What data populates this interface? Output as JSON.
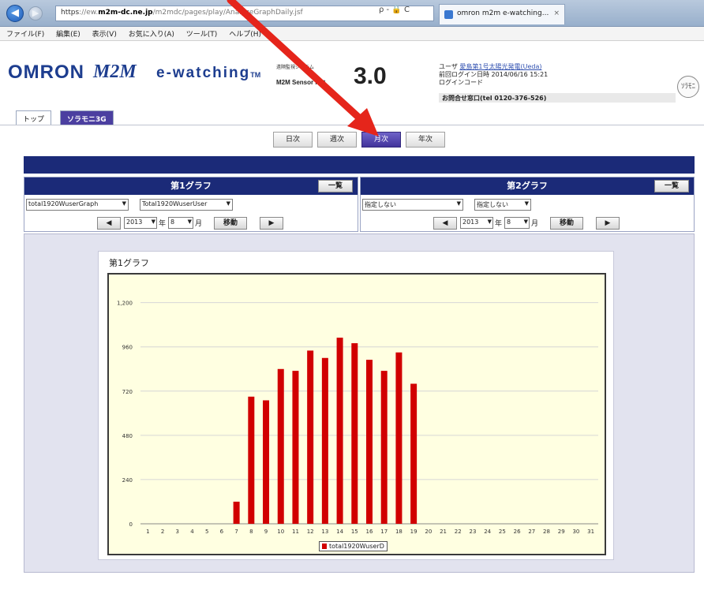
{
  "browser": {
    "url_scheme": "https",
    "url_host_prefix": "://ew.",
    "url_host": "m2m-dc.ne.jp",
    "url_path": "/m2mdc/pages/play/AnalyzeGraphDaily.jsf",
    "url_tools": "ρ - 🔒 C",
    "tab_title": "omron m2m e-watching...",
    "tab_close": "×"
  },
  "menu": [
    "ファイル(F)",
    "編集(E)",
    "表示(V)",
    "お気に入り(A)",
    "ツール(T)",
    "ヘルプ(H)"
  ],
  "header": {
    "brand": "OMRON",
    "product_m2m": "M2M",
    "product_ew": "e-watching",
    "tm": "TM",
    "sys_caption": "遠隔監視システム",
    "sys_name": "M2M Sensor Net",
    "version": "3.0",
    "user_label": "ユーザ",
    "user_name": "愛島第1号太陽光発電(Ueda)",
    "last_login_label": "前回ログイン日時",
    "last_login": "2014/06/16 15:21",
    "user_code_label": "ログインコード",
    "contact": "お問合せ窓口(tel 0120-376-526)",
    "right_icon": "ｿﾗﾓﾆ"
  },
  "site_tabs": {
    "top": "トップ",
    "sora": "ソラモニ3G"
  },
  "period": {
    "daily": "日次",
    "weekly": "週次",
    "monthly": "月次",
    "yearly": "年次"
  },
  "panel1": {
    "title": "第1グラフ",
    "list_btn": "一覧",
    "select1": "total1920WuserGraph",
    "select2": "Total1920WuserUser",
    "year": "2013",
    "year_unit": "年",
    "month": "8",
    "month_unit": "月",
    "move_btn": "移動",
    "prev": "◀",
    "next": "▶"
  },
  "panel2": {
    "title": "第2グラフ",
    "list_btn": "一覧",
    "select1": "指定しない",
    "select2": "指定しない",
    "year": "2013",
    "year_unit": "年",
    "month": "8",
    "month_unit": "月",
    "move_btn": "移動",
    "prev": "◀",
    "next": "▶"
  },
  "colors": {
    "navy": "#1b2a78",
    "bar": "#d10000",
    "plot_bg": "#ffffe1",
    "annot_arrow": "#e5251b"
  },
  "chart_data": {
    "type": "bar",
    "title": "第1グラフ",
    "categories": [
      "1",
      "2",
      "3",
      "4",
      "5",
      "6",
      "7",
      "8",
      "9",
      "10",
      "11",
      "12",
      "13",
      "14",
      "15",
      "16",
      "17",
      "18",
      "19",
      "20",
      "21",
      "22",
      "23",
      "24",
      "25",
      "26",
      "27",
      "28",
      "29",
      "30",
      "31"
    ],
    "series": [
      {
        "name": "total1920WuserD",
        "values": [
          0,
          0,
          0,
          0,
          0,
          0,
          120,
          690,
          670,
          840,
          830,
          940,
          900,
          1010,
          980,
          890,
          830,
          930,
          760,
          0,
          0,
          0,
          0,
          0,
          0,
          0,
          0,
          0,
          0,
          0,
          0
        ]
      }
    ],
    "yticks": [
      "0",
      "240",
      "480",
      "720",
      "960",
      "1,200"
    ],
    "ylim": [
      0,
      1250
    ],
    "grid": true,
    "legend_position": "bottom"
  }
}
